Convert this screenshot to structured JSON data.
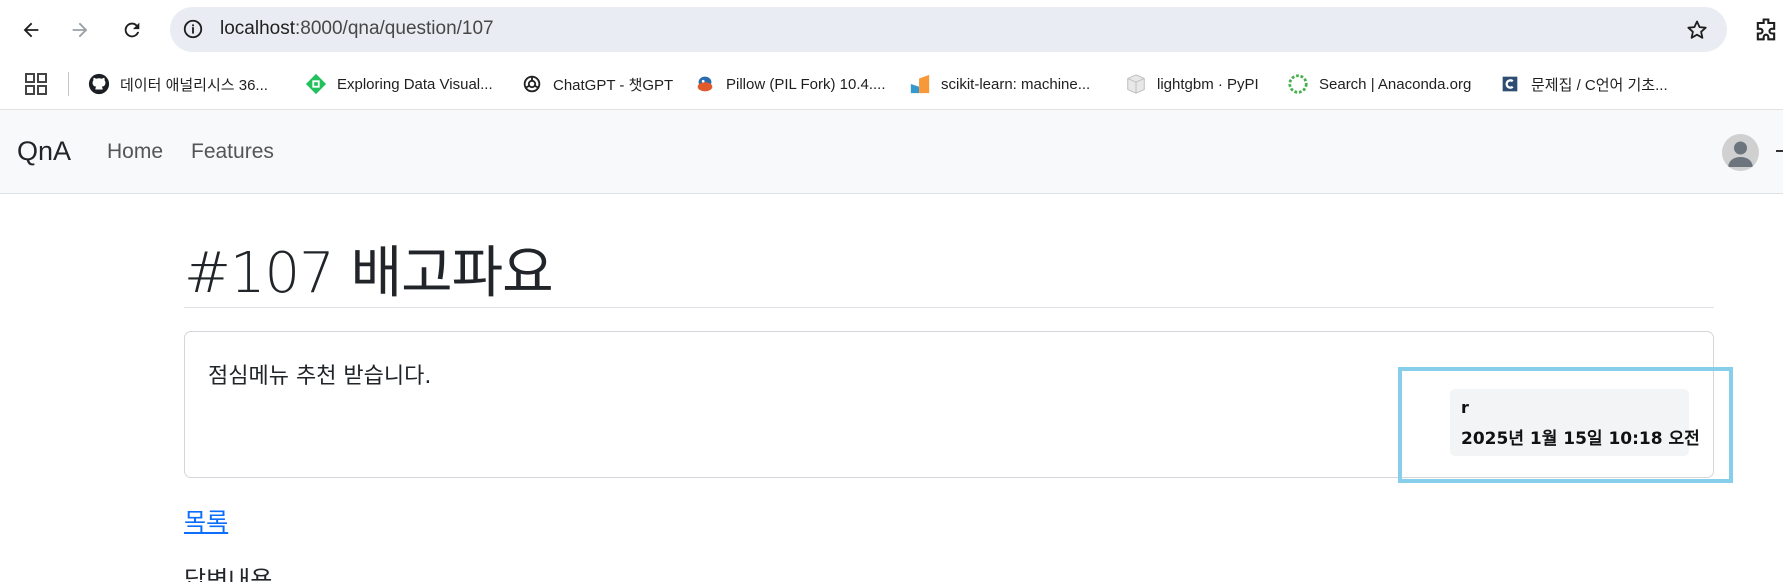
{
  "browser": {
    "url_host": "localhost",
    "url_path": ":8000/qna/question/107",
    "bookmarks": [
      {
        "label": "데이터 애널리시스 36...",
        "icon": "github-icon"
      },
      {
        "label": "Exploring Data Visual...",
        "icon": "diamond-icon"
      },
      {
        "label": "ChatGPT - 챗GPT",
        "icon": "openai-icon"
      },
      {
        "label": "Pillow (PIL Fork) 10.4....",
        "icon": "pillow-icon"
      },
      {
        "label": "scikit-learn: machine...",
        "icon": "sklearn-icon"
      },
      {
        "label": "lightgbm · PyPI",
        "icon": "pypi-icon"
      },
      {
        "label": "Search | Anaconda.org",
        "icon": "anaconda-icon"
      },
      {
        "label": "문제집 / C언어 기초...",
        "icon": "codeup-icon"
      }
    ]
  },
  "navbar": {
    "brand": "QnA",
    "links": [
      "Home",
      "Features"
    ]
  },
  "question": {
    "title": "#107 배고파요",
    "content": "점심메뉴 추천 받습니다.",
    "author": "r",
    "created": "2025년 1월 15일 10:18 오전"
  },
  "list_link": "목록",
  "answers_heading": "답변내용",
  "colors": {
    "link": "#0d6efd",
    "navbar_bg": "#f8f9fa",
    "highlight": "#87ceeb"
  }
}
